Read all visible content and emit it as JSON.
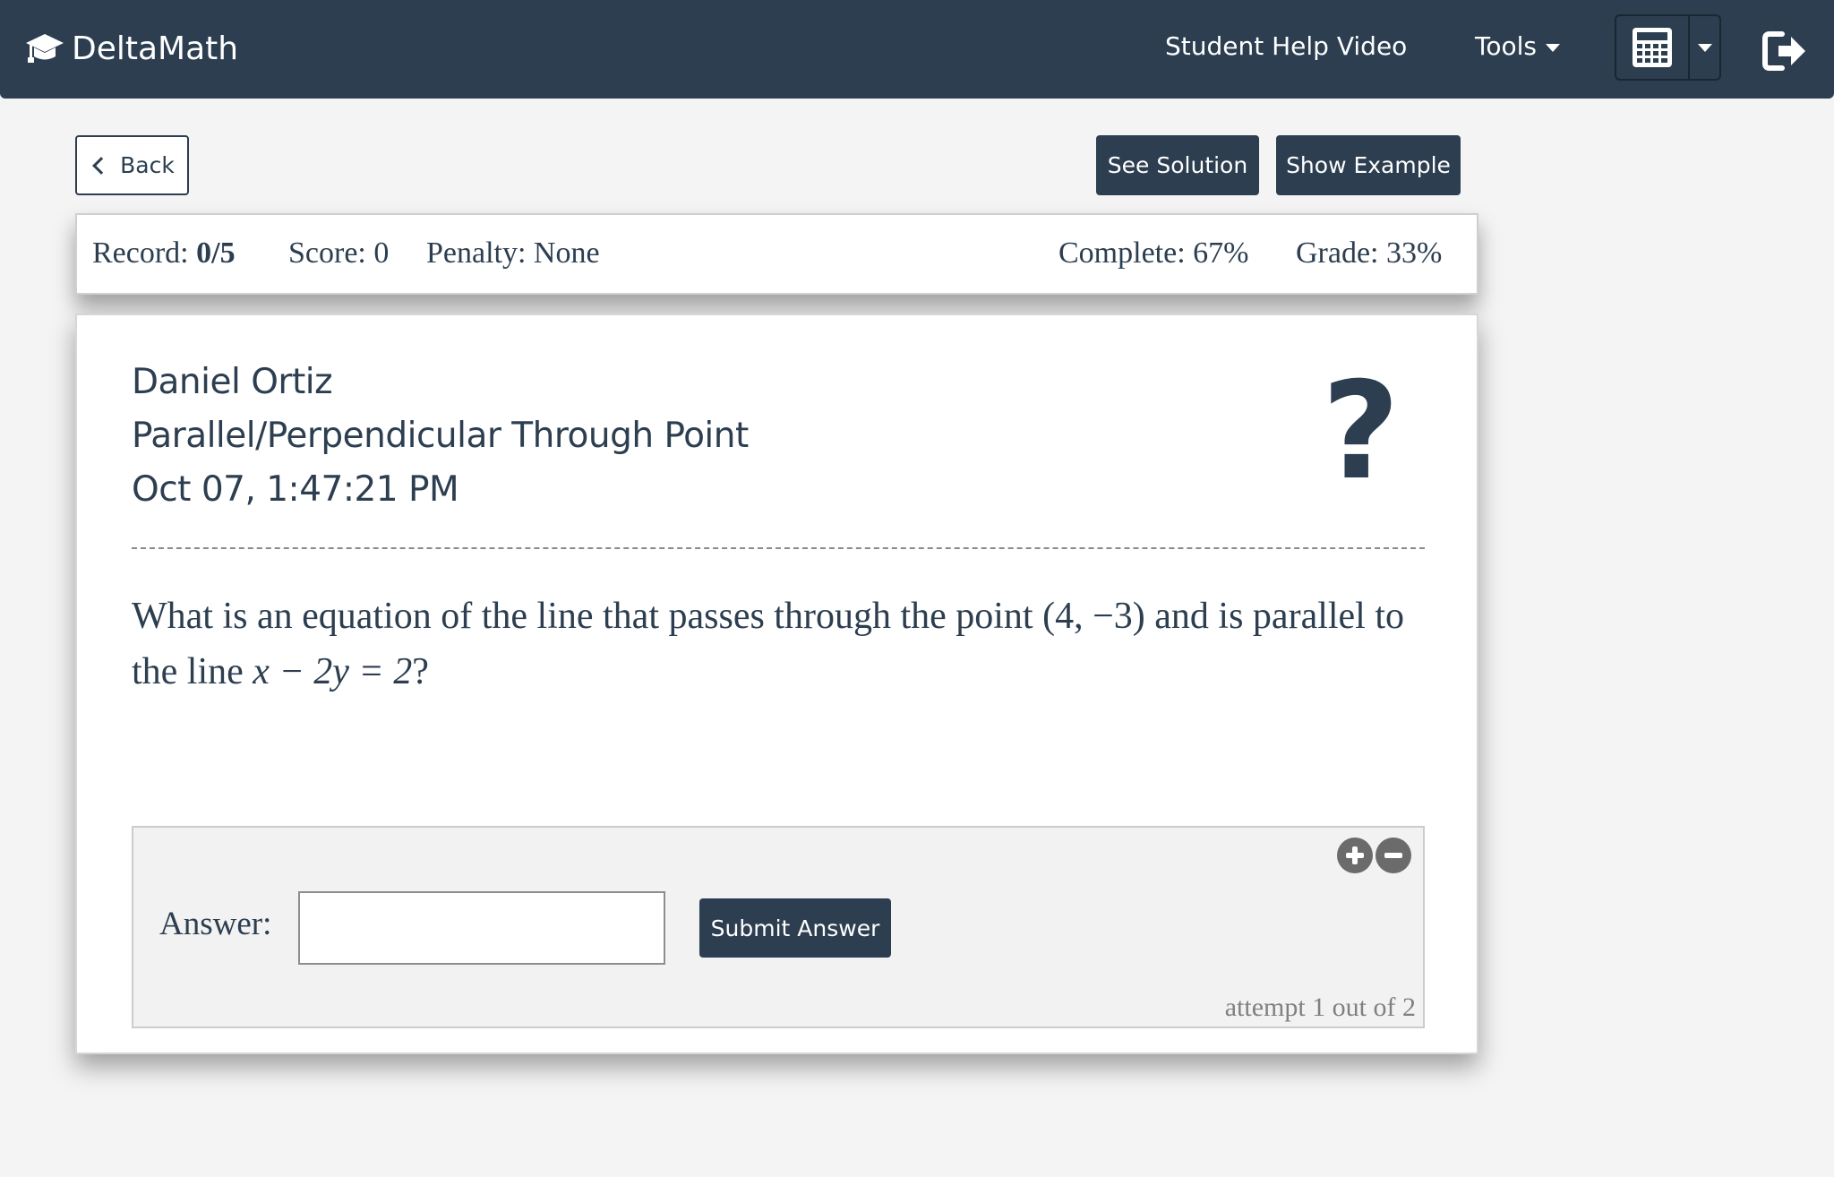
{
  "nav": {
    "brand": "DeltaMath",
    "help_link": "Student Help Video",
    "tools_label": "Tools"
  },
  "toolbar": {
    "back_label": "Back",
    "solution_label": "See Solution",
    "example_label": "Show Example"
  },
  "record": {
    "record_label": "Record:",
    "record_value": "0/5",
    "score": "Score: 0",
    "penalty": "Penalty: None",
    "complete": "Complete: 67%",
    "grade": "Grade: 33%"
  },
  "problem": {
    "student": "Daniel Ortiz",
    "topic": "Parallel/Perpendicular Through Point",
    "timestamp": "Oct 07, 1:47:21 PM",
    "question_before": "What is an equation of the line that passes through the point ",
    "point": "(4, −3)",
    "question_middle": " and is parallel to the line ",
    "equation": "x − 2y = 2",
    "question_after": "?"
  },
  "answer": {
    "label": "Answer:",
    "value": "",
    "submit_label": "Submit Answer",
    "attempt": "attempt 1 out of 2"
  },
  "colors": {
    "navbar": "#2c3e50",
    "button_dark": "#2c3e50",
    "background": "#f4f4f4"
  },
  "icons": [
    "graduation-cap-icon",
    "caret-down-icon",
    "calculator-icon",
    "logout-icon",
    "chevron-left-icon",
    "help-question-icon",
    "zoom-in-icon",
    "zoom-out-icon"
  ]
}
